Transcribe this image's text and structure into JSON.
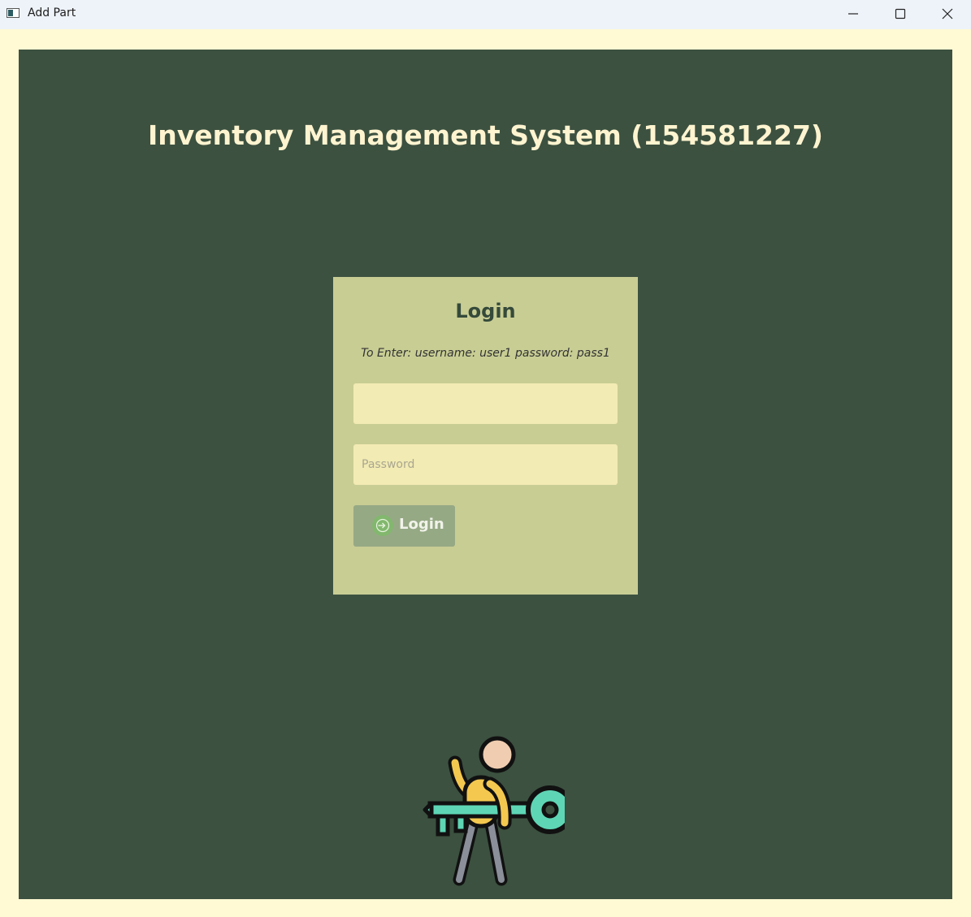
{
  "window": {
    "title": "Add Part",
    "minimize_icon": "minimize-icon",
    "maximize_icon": "maximize-icon",
    "close_icon": "close-icon"
  },
  "header": {
    "title": "Inventory Management System (154581227)"
  },
  "login": {
    "title": "Login",
    "hint": "To Enter: username: user1 password: pass1",
    "username": {
      "value": "",
      "placeholder": ""
    },
    "password": {
      "value": "",
      "placeholder": "Password"
    },
    "button_label": "Login",
    "button_icon": "login-arrow-icon"
  },
  "illustration": {
    "icon": "person-with-key-icon"
  },
  "colors": {
    "window_background": "#fffad4",
    "panel": "#3c5140",
    "card": "#c8cd94",
    "input": "#f2ebb3",
    "button": "#96a985",
    "heading_text": "#fff4d0"
  }
}
